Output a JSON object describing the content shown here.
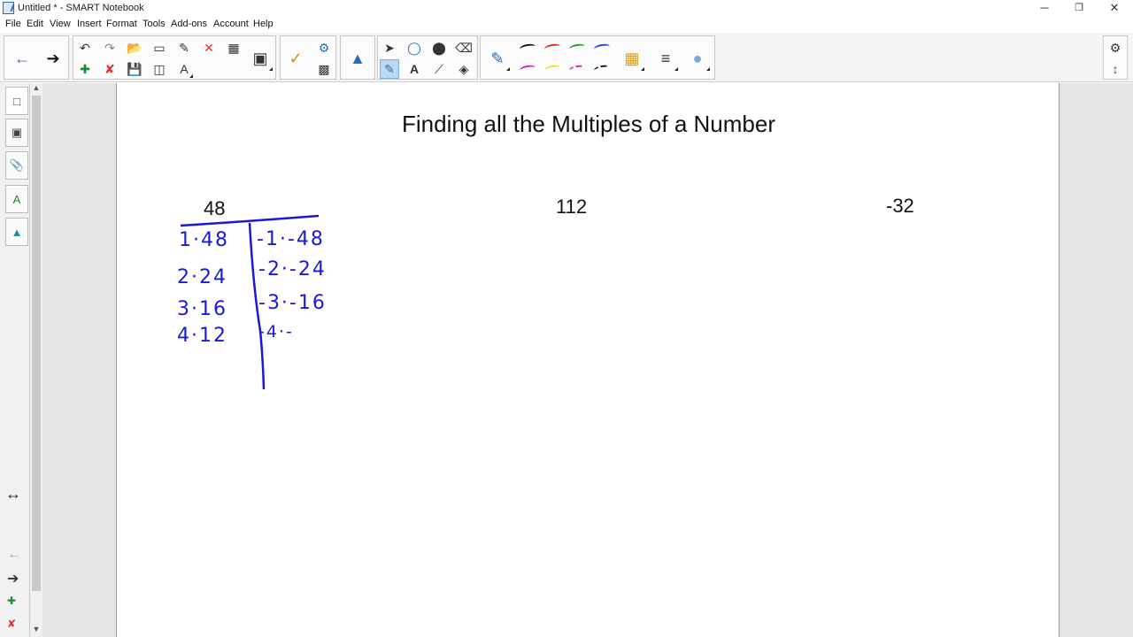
{
  "window": {
    "title": "Untitled * - SMART Notebook"
  },
  "window_controls": {
    "minimize": "─",
    "restore": "❐",
    "close": "✕"
  },
  "menu": [
    "File",
    "Edit",
    "View",
    "Insert",
    "Format",
    "Tools",
    "Add-ons",
    "Account",
    "Help"
  ],
  "page": {
    "title": "Finding all the Multiples of a Number",
    "numbers": [
      "48",
      "112",
      "-32"
    ],
    "handwriting": {
      "left_col": [
        "1·48",
        "2·24",
        "3·16",
        "4·12"
      ],
      "right_col": [
        "-1·-48",
        "-2·-24",
        "-3·-16",
        "-4·-"
      ]
    }
  },
  "colors": {
    "ink": "#1a1ad6",
    "pen_black": "#111111",
    "pen_red": "#e0202a",
    "pen_green": "#1aa01a",
    "pen_blue": "#2040d0",
    "pen_magenta": "#d020c0",
    "pen_yellow": "#f0e020"
  }
}
